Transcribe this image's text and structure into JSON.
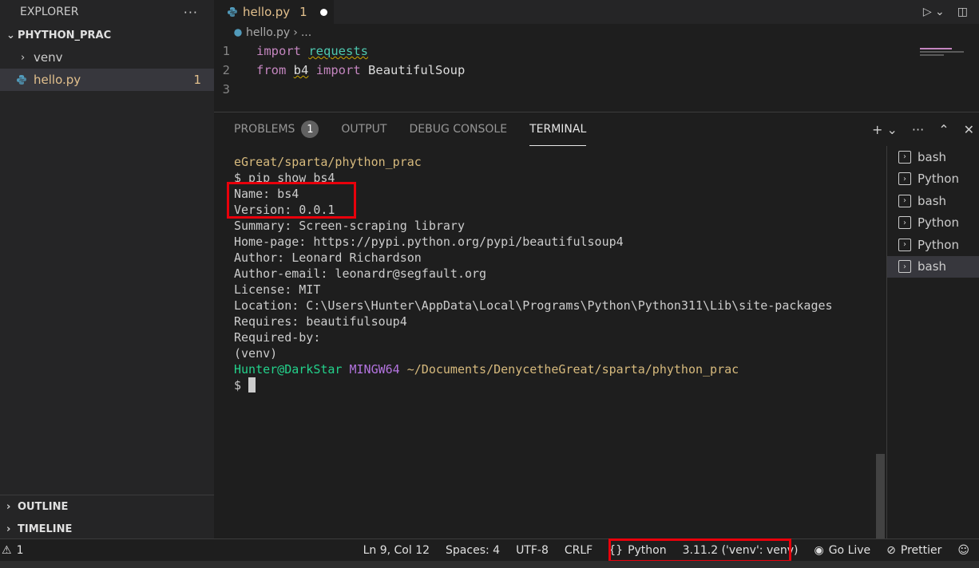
{
  "sidebar": {
    "header": "EXPLORER",
    "more": "···",
    "root_folder": "PHYTHON_PRAC",
    "items": [
      {
        "label": "venv"
      },
      {
        "label": "hello.py",
        "badge": "1"
      }
    ],
    "sections": [
      "OUTLINE",
      "TIMELINE"
    ]
  },
  "editor": {
    "tab": {
      "label": "hello.py",
      "problems": "1"
    },
    "breadcrumbs": [
      "hello.py",
      "..."
    ],
    "lines": [
      {
        "num": "1",
        "kw": "import",
        "mod": "requests"
      },
      {
        "num": "2",
        "kw": "from",
        "mod": "b4",
        "kw2": "import",
        "name": "BeautifulSoup"
      },
      {
        "num": "3"
      }
    ]
  },
  "panel": {
    "tabs": [
      "PROBLEMS",
      "OUTPUT",
      "DEBUG CONSOLE",
      "TERMINAL"
    ],
    "problems_count": "1",
    "active_tab": "TERMINAL",
    "terminal_lines": [
      "eGreat/sparta/phython_prac",
      "$ pip show bs4",
      "Name: bs4",
      "Version: 0.0.1",
      "Summary: Screen-scraping library",
      "Home-page: https://pypi.python.org/pypi/beautifulsoup4",
      "Author: Leonard Richardson",
      "Author-email: leonardr@segfault.org",
      "License: MIT",
      "Location: C:\\Users\\Hunter\\AppData\\Local\\Programs\\Python\\Python311\\Lib\\site-packages",
      "Requires: beautifulsoup4",
      "Required-by:",
      "(venv)"
    ],
    "prompt": {
      "user": "Hunter@DarkStar",
      "shell": "MINGW64",
      "path": "~/Documents/DenycetheGreat/sparta/phython_prac",
      "symbol": "$"
    },
    "terminals": [
      "bash",
      "Python",
      "bash",
      "Python",
      "Python",
      "bash"
    ]
  },
  "statusbar": {
    "warnings": "1",
    "position": "Ln 9, Col 12",
    "spaces": "Spaces: 4",
    "encoding": "UTF-8",
    "eol": "CRLF",
    "language": "Python",
    "interpreter": "3.11.2 ('venv': venv)",
    "golive": "Go Live",
    "prettier": "Prettier"
  },
  "colors": {
    "accent_highlight": "#e8000b",
    "file_modified": "#e2c08d",
    "prompt_user": "#23d18b",
    "prompt_shell": "#b474e0"
  }
}
